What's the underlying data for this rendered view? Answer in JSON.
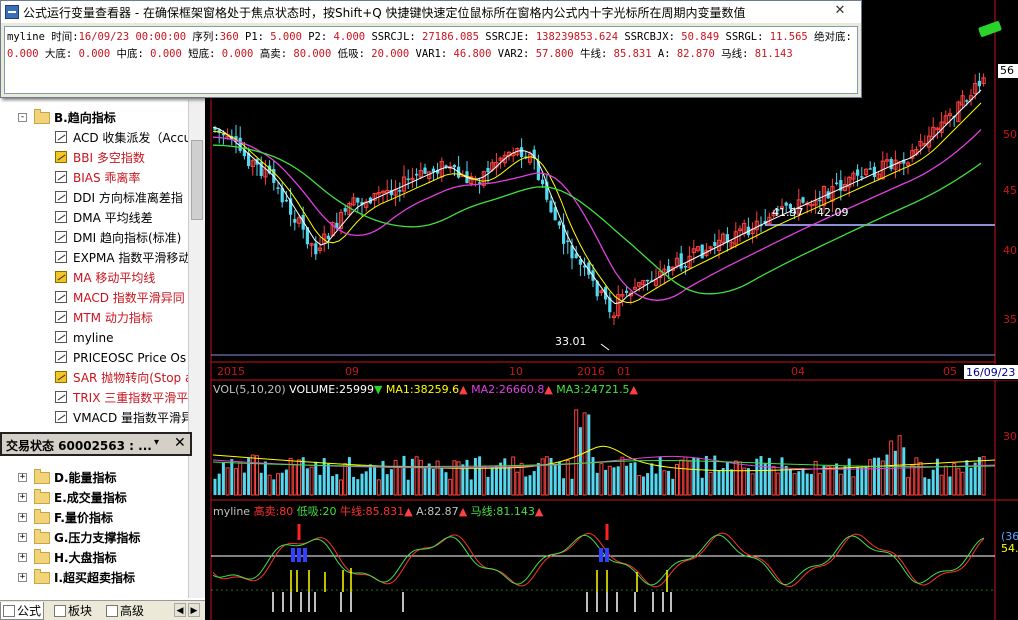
{
  "window": {
    "title": "公式运行变量查看器 - 在确保框架窗格处于焦点状态时，按Shift+Q 快捷键快速定位鼠标所在窗格内公式内十字光标所在周期内变量数值",
    "close_label": "✕",
    "line1": [
      {
        "k": "myline 时间:",
        "v": "16/09/23 00:00:00"
      },
      {
        "k": " 序列:",
        "v": "360"
      },
      {
        "k": "  P1:",
        "v": " 5.000"
      },
      {
        "k": " P2:",
        "v": " 4.000"
      },
      {
        "k": " SSRCJL:",
        "v": " 27186.085"
      },
      {
        "k": " SSRCJE:",
        "v": " 138239853.624"
      },
      {
        "k": " SSRCBJX:",
        "v": " 50.849"
      },
      {
        "k": " SSRGL:",
        "v": " 11.565"
      },
      {
        "k": " 绝对底:",
        "v": ""
      }
    ],
    "line2": [
      {
        "k": "",
        "v": "0.000"
      },
      {
        "k": " 大底:",
        "v": " 0.000"
      },
      {
        "k": " 中底:",
        "v": " 0.000"
      },
      {
        "k": " 短底:",
        "v": " 0.000"
      },
      {
        "k": " 高卖:",
        "v": " 80.000"
      },
      {
        "k": " 低吸:",
        "v": " 20.000"
      },
      {
        "k": " VAR1:",
        "v": " 46.800"
      },
      {
        "k": " VAR2:",
        "v": " 57.800"
      },
      {
        "k": " 牛线:",
        "v": " 85.831"
      },
      {
        "k": " A:",
        "v": " 82.870"
      },
      {
        "k": " 马线:",
        "v": " 81.143"
      }
    ]
  },
  "tree": {
    "items": [
      {
        "kind": "category",
        "label": "B.趋向指标",
        "expanded": true
      },
      {
        "kind": "formula",
        "label": "ACD 收集派发（Accu",
        "red": false,
        "hl": false
      },
      {
        "kind": "formula",
        "label": "BBI 多空指数",
        "red": true,
        "hl": true
      },
      {
        "kind": "formula",
        "label": "BIAS 乖离率",
        "red": true,
        "hl": false
      },
      {
        "kind": "formula",
        "label": "DDI 方向标准离差指",
        "red": false,
        "hl": false
      },
      {
        "kind": "formula",
        "label": "DMA 平均线差",
        "red": false,
        "hl": false
      },
      {
        "kind": "formula",
        "label": "DMI 趋向指标(标准)",
        "red": false,
        "hl": false
      },
      {
        "kind": "formula",
        "label": "EXPMA 指数平滑移动",
        "red": false,
        "hl": false
      },
      {
        "kind": "formula",
        "label": "MA 移动平均线",
        "red": true,
        "hl": true
      },
      {
        "kind": "formula",
        "label": "MACD 指数平滑异同",
        "red": true,
        "hl": false
      },
      {
        "kind": "formula",
        "label": "MTM 动力指标",
        "red": true,
        "hl": false
      },
      {
        "kind": "formula",
        "label": "myline",
        "red": false,
        "hl": false
      },
      {
        "kind": "formula",
        "label": "PRICEOSC Price Os",
        "red": false,
        "hl": false
      },
      {
        "kind": "formula",
        "label": "SAR 抛物转向(Stop a",
        "red": true,
        "hl": true
      },
      {
        "kind": "formula",
        "label": "TRIX 三重指数平滑平",
        "red": true,
        "hl": false
      },
      {
        "kind": "formula",
        "label": "VMACD 量指数平滑异",
        "red": false,
        "hl": false
      }
    ],
    "lower": [
      {
        "label": "D.能量指标"
      },
      {
        "label": "E.成交量指标"
      },
      {
        "label": "F.量价指标"
      },
      {
        "label": "G.压力支撑指标"
      },
      {
        "label": "H.大盘指标"
      },
      {
        "label": "I.超买超卖指标"
      }
    ]
  },
  "trade_bar": {
    "title": "交易状态 60002563 : ...",
    "pin": "▾",
    "close": "✕"
  },
  "left_tabs": {
    "formula": "公式",
    "block": "板块",
    "advanced": "高级"
  },
  "chart": {
    "price_tag": "56",
    "date_box": "16/09/23",
    "low_label": "33.01",
    "mid_label_1": "41.97",
    "mid_label_2": "42.09",
    "x_labels": [
      "2015",
      "09",
      "10",
      "2016",
      "01",
      "04",
      "05"
    ],
    "price_axis": [
      "50",
      "45",
      "40",
      "35"
    ],
    "vol_axis": "30",
    "osc_axis": [
      "(36",
      "54."
    ],
    "volume_header": [
      {
        "text": "VOL(5,10,20)",
        "color": "#c0c0c0"
      },
      {
        "text": " VOLUME:25999",
        "color": "#ffffff"
      },
      {
        "text": "▼",
        "color": "#2ad32a"
      },
      {
        "text": " MA1:38259.6",
        "color": "#ffff00"
      },
      {
        "text": "▲",
        "color": "#ff4040"
      },
      {
        "text": " MA2:26660.8",
        "color": "#e040e0"
      },
      {
        "text": "▲",
        "color": "#ff4040"
      },
      {
        "text": " MA3:24721.5",
        "color": "#40e040"
      },
      {
        "text": "▲",
        "color": "#ff4040"
      }
    ],
    "osc_header": [
      {
        "text": "myline",
        "color": "#c0c0c0"
      },
      {
        "text": " 高卖:80",
        "color": "#ff3030"
      },
      {
        "text": " 低吸:20",
        "color": "#40e040"
      },
      {
        "text": " 牛线:85.831",
        "color": "#ff3030"
      },
      {
        "text": "▲",
        "color": "#ff4040"
      },
      {
        "text": " A:82.87",
        "color": "#c0c0c0"
      },
      {
        "text": "▲",
        "color": "#ff4040"
      },
      {
        "text": " 马线:81.143",
        "color": "#40e040"
      },
      {
        "text": "▲",
        "color": "#ff4040"
      }
    ],
    "colors": {
      "up": "#ff4040",
      "down": "#54d8f0",
      "ma5": "#ffffff",
      "ma10": "#ffff00",
      "ma20": "#e040e0",
      "ma60": "#40e040",
      "axis": "#c8141e"
    }
  },
  "chart_data": {
    "type": "candlestick",
    "price_axis_ticks": [
      50,
      45,
      40,
      35
    ],
    "annotations": [
      "33.01",
      "41.97",
      "42.09"
    ],
    "last_price_tag": "56"
  }
}
